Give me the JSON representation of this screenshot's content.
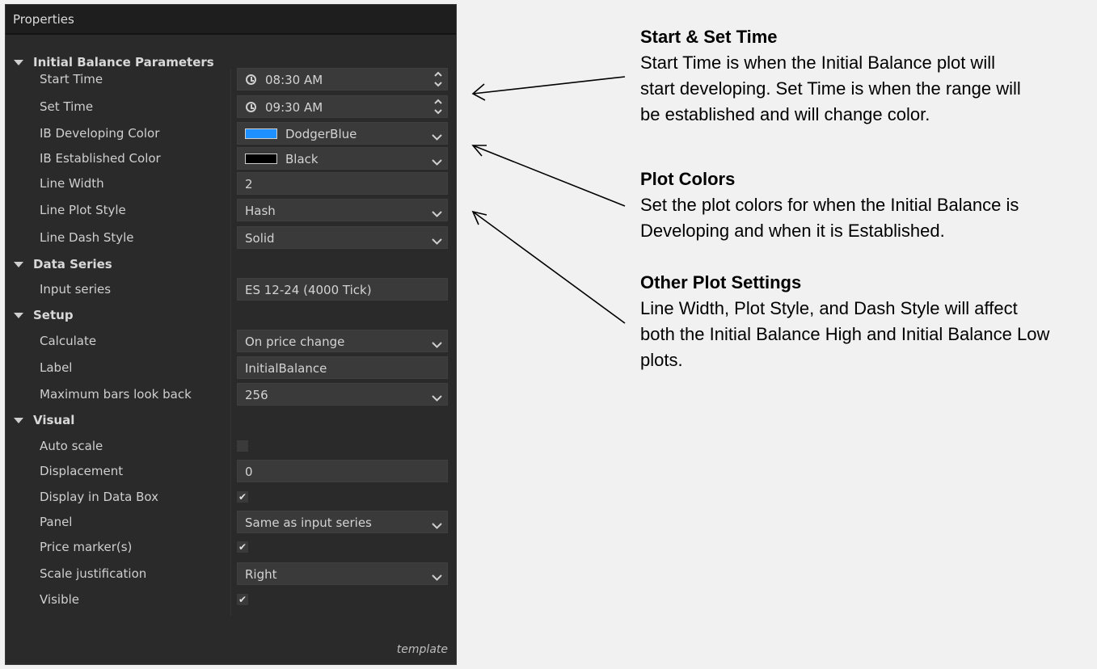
{
  "panel": {
    "title": "Properties",
    "footer": "template",
    "categories": [
      {
        "name": "Initial Balance Parameters",
        "rows": [
          {
            "label": "Start Time",
            "value": "08:30 AM",
            "type": "time"
          },
          {
            "label": "Set Time",
            "value": "09:30 AM",
            "type": "time"
          },
          {
            "label": "IB Developing Color",
            "value": "DodgerBlue",
            "type": "color",
            "color": "#1e90ff"
          },
          {
            "label": "IB Established Color",
            "value": "Black",
            "type": "color",
            "color": "#000000"
          },
          {
            "label": "Line Width",
            "value": "2",
            "type": "text"
          },
          {
            "label": "Line Plot Style",
            "value": "Hash",
            "type": "select"
          },
          {
            "label": "Line Dash Style",
            "value": "Solid",
            "type": "select"
          }
        ]
      },
      {
        "name": "Data Series",
        "rows": [
          {
            "label": "Input series",
            "value": "ES 12-24 (4000 Tick)",
            "type": "text"
          }
        ]
      },
      {
        "name": "Setup",
        "rows": [
          {
            "label": "Calculate",
            "value": "On price change",
            "type": "select"
          },
          {
            "label": "Label",
            "value": "InitialBalance",
            "type": "text"
          },
          {
            "label": "Maximum bars look back",
            "value": "256",
            "type": "select"
          }
        ]
      },
      {
        "name": "Visual",
        "rows": [
          {
            "label": "Auto scale",
            "checked": false,
            "type": "check"
          },
          {
            "label": "Displacement",
            "value": "0",
            "type": "text"
          },
          {
            "label": "Display in Data Box",
            "checked": true,
            "type": "check"
          },
          {
            "label": "Panel",
            "value": "Same as input series",
            "type": "select"
          },
          {
            "label": "Price marker(s)",
            "checked": true,
            "type": "check"
          },
          {
            "label": "Scale justification",
            "value": "Right",
            "type": "select"
          },
          {
            "label": "Visible",
            "checked": true,
            "type": "check"
          }
        ]
      }
    ]
  },
  "annotations": [
    {
      "title": "Start & Set Time",
      "lines": [
        "Start Time is when the Initial Balance plot will",
        "start developing. Set Time is when the range will",
        "be established and will change color."
      ]
    },
    {
      "title": "Plot Colors",
      "lines": [
        "Set the plot colors for when the Initial Balance is",
        "Developing and when it is Established."
      ]
    },
    {
      "title": "Other Plot Settings",
      "lines": [
        "Line Width, Plot Style, and Dash Style will affect",
        "both the Initial Balance High and Initial Balance Low",
        "plots."
      ]
    }
  ],
  "icons": {
    "time": "clock-icon",
    "spin_up": "spin-up-icon",
    "spin_down": "spin-down-icon",
    "dropdown": "chevron-down-icon",
    "category": "caret-down-icon",
    "check": "checkmark-icon"
  }
}
